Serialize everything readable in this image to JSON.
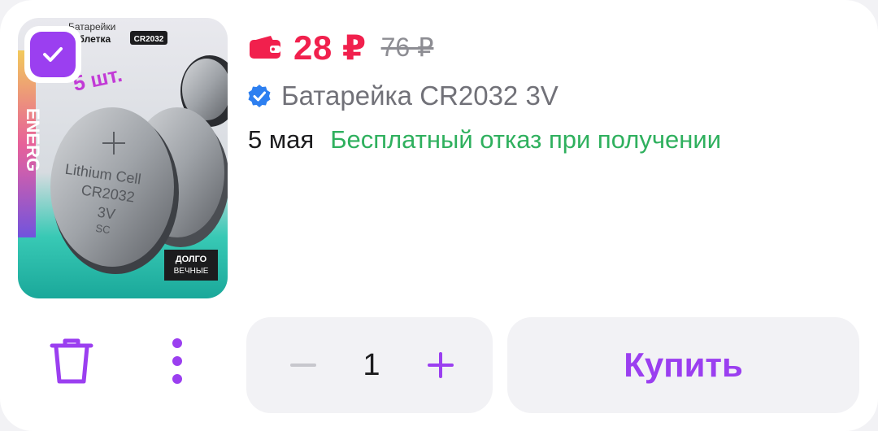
{
  "product": {
    "image_text": {
      "line1": "Батарейки",
      "line2": "таблетка",
      "model_badge": "CR2032",
      "count": "5 шт.",
      "coin_line1": "Lithium Cell",
      "coin_line2": "CR2032",
      "coin_line3": "3V",
      "coin_line4": "SC",
      "side_brand": "ENERG",
      "promo_line1": "ДОЛГО",
      "promo_line2": "ВЕЧНЫЕ"
    },
    "selected": true,
    "price": "28 ₽",
    "old_price": "76 ₽",
    "title": "Батарейка CR2032 3V",
    "delivery_date": "5 мая",
    "return_note": "Бесплатный отказ при получении"
  },
  "cart": {
    "quantity": "1",
    "buy_label": "Купить"
  },
  "colors": {
    "accent": "#9b3ff0",
    "price": "#f1204d",
    "success": "#2fb05e",
    "verified": "#2d7ff0"
  },
  "icons": {
    "wallet": "wallet-icon",
    "verified": "verified-badge-icon",
    "check": "checkmark-icon",
    "delete": "trash-icon",
    "more": "more-vertical-icon",
    "minus": "minus-icon",
    "plus": "plus-icon"
  }
}
